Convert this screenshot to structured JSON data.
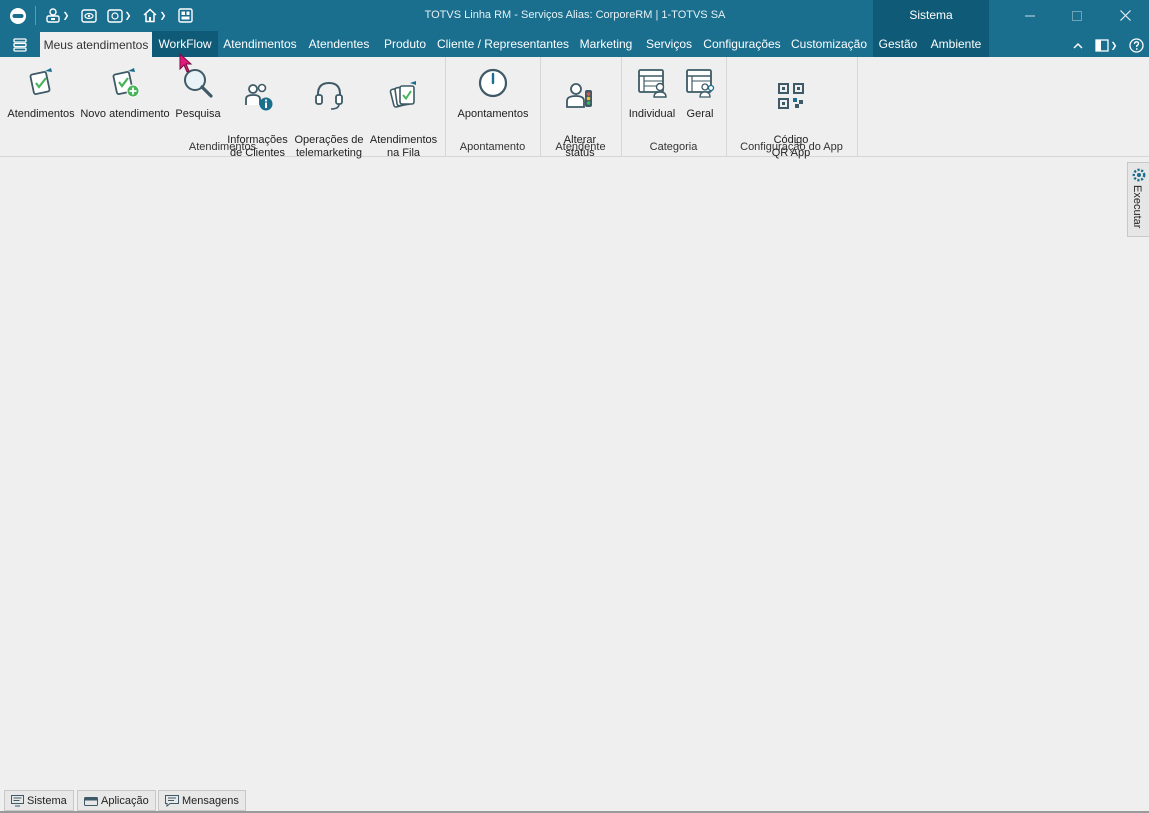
{
  "window": {
    "title": "TOTVS Linha RM - Serviços  Alias: CorporeRM | 1-TOTVS SA",
    "context_tab": "Sistema",
    "accent_color": "#1a6e8e",
    "context_color": "#0f5a77"
  },
  "quick_access": {
    "icons": [
      "totvs-logo-icon",
      "user-settings-icon",
      "eye-icon",
      "capture-icon",
      "home-icon",
      "layout-icon"
    ]
  },
  "tabs": [
    {
      "label": "Meus atendimentos"
    },
    {
      "label": "WorkFlow"
    },
    {
      "label": "Atendimentos"
    },
    {
      "label": "Atendentes"
    },
    {
      "label": "Produto"
    },
    {
      "label": "Cliente / Representantes"
    },
    {
      "label": "Marketing"
    },
    {
      "label": "Serviços"
    },
    {
      "label": "Configurações"
    },
    {
      "label": "Customização"
    },
    {
      "label": "Gestão"
    },
    {
      "label": "Ambiente"
    }
  ],
  "ribbon": {
    "buttons": [
      {
        "label": "Atendimentos"
      },
      {
        "label": "Novo atendimento"
      },
      {
        "label": "Pesquisa"
      },
      {
        "label": "Informações\nde Clientes"
      },
      {
        "label": "Operações de\ntelemarketing"
      },
      {
        "label": "Atendimentos\nna Fila"
      },
      {
        "label": "Apontamentos"
      },
      {
        "label": "Alterar\nstatus"
      },
      {
        "label": "Individual"
      },
      {
        "label": "Geral"
      },
      {
        "label": "Código\nQR App"
      }
    ],
    "groups": [
      {
        "label": "Atendimentos"
      },
      {
        "label": "Apontamento"
      },
      {
        "label": "Atendente"
      },
      {
        "label": "Categoria"
      },
      {
        "label": "Configuração do App"
      }
    ]
  },
  "side_panel": {
    "label": "Executar"
  },
  "status_bar": {
    "buttons": [
      {
        "label": "Sistema"
      },
      {
        "label": "Aplicação"
      },
      {
        "label": "Mensagens"
      }
    ]
  }
}
